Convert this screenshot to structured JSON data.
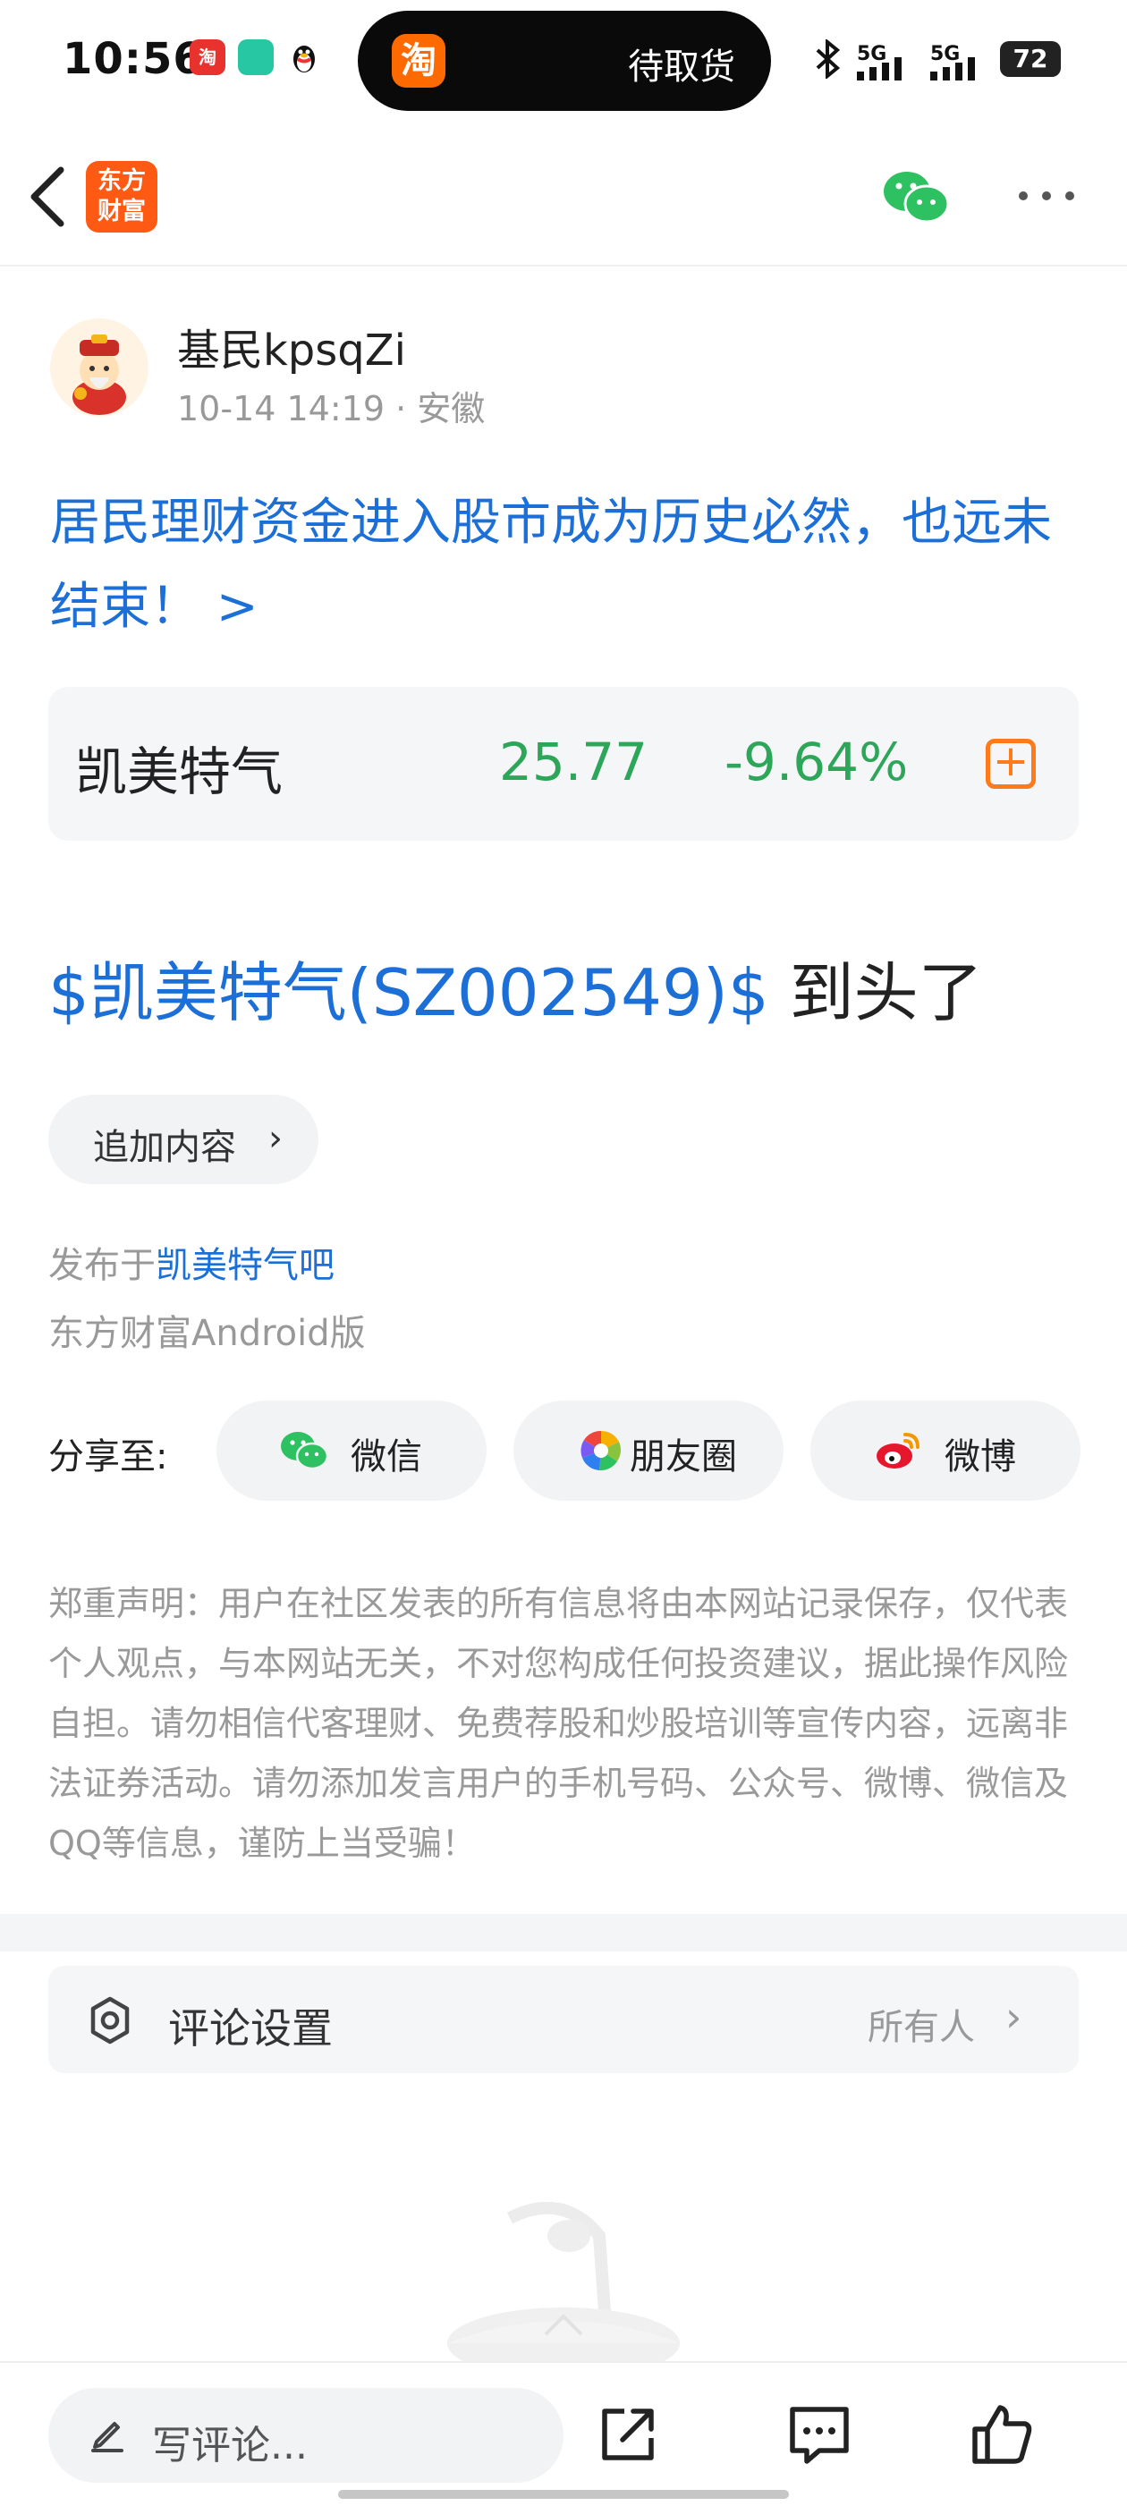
{
  "status_bar": {
    "time": "10:56",
    "island_app": "淘",
    "island_text": "待取货",
    "network_1": "5G",
    "network_2": "5G",
    "battery": "72",
    "app_icon_1": "淘",
    "app_icon_2": "",
    "app_icon_3": ""
  },
  "nav": {
    "logo_line1": "东方",
    "logo_line2": "财富"
  },
  "post": {
    "author": "基民kpsqZi",
    "meta": "10-14 14:19 · 安徽",
    "title": "居民理财资金进入股市成为历史必然，也远未结束！ >",
    "stock": {
      "name": "凯美特气",
      "price": "25.77",
      "change": "-9.64%",
      "add_symbol": "+"
    },
    "stock_tag": "$凯美特气(SZ002549)$",
    "body_text": " 到头了",
    "append_label": "追加内容",
    "append_chevron": "›",
    "published_prefix": "发布于",
    "forum": "凯美特气吧",
    "client": "东方财富Android版"
  },
  "share": {
    "label": "分享至:",
    "options": [
      {
        "label": "微信",
        "icon": "wechat-icon"
      },
      {
        "label": "朋友圈",
        "icon": "moments-icon"
      },
      {
        "label": "微博",
        "icon": "weibo-icon"
      }
    ]
  },
  "disclaimer": "郑重声明：用户在社区发表的所有信息将由本网站记录保存，仅代表个人观点，与本网站无关，不对您构成任何投资建议，据此操作风险自担。请勿相信代客理财、免费荐股和炒股培训等宣传内容，远离非法证券活动。请勿添加发言用户的手机号码、公众号、微博、微信及QQ等信息，谨防上当受骗！",
  "comment_settings": {
    "label": "评论设置",
    "value": "所有人",
    "chevron": "›"
  },
  "bottom_bar": {
    "comment_placeholder": "写评论..."
  },
  "colors": {
    "link_blue": "#1b6fd6",
    "stock_down_green": "#2ea65a",
    "brand_orange": "#ff5a14"
  }
}
